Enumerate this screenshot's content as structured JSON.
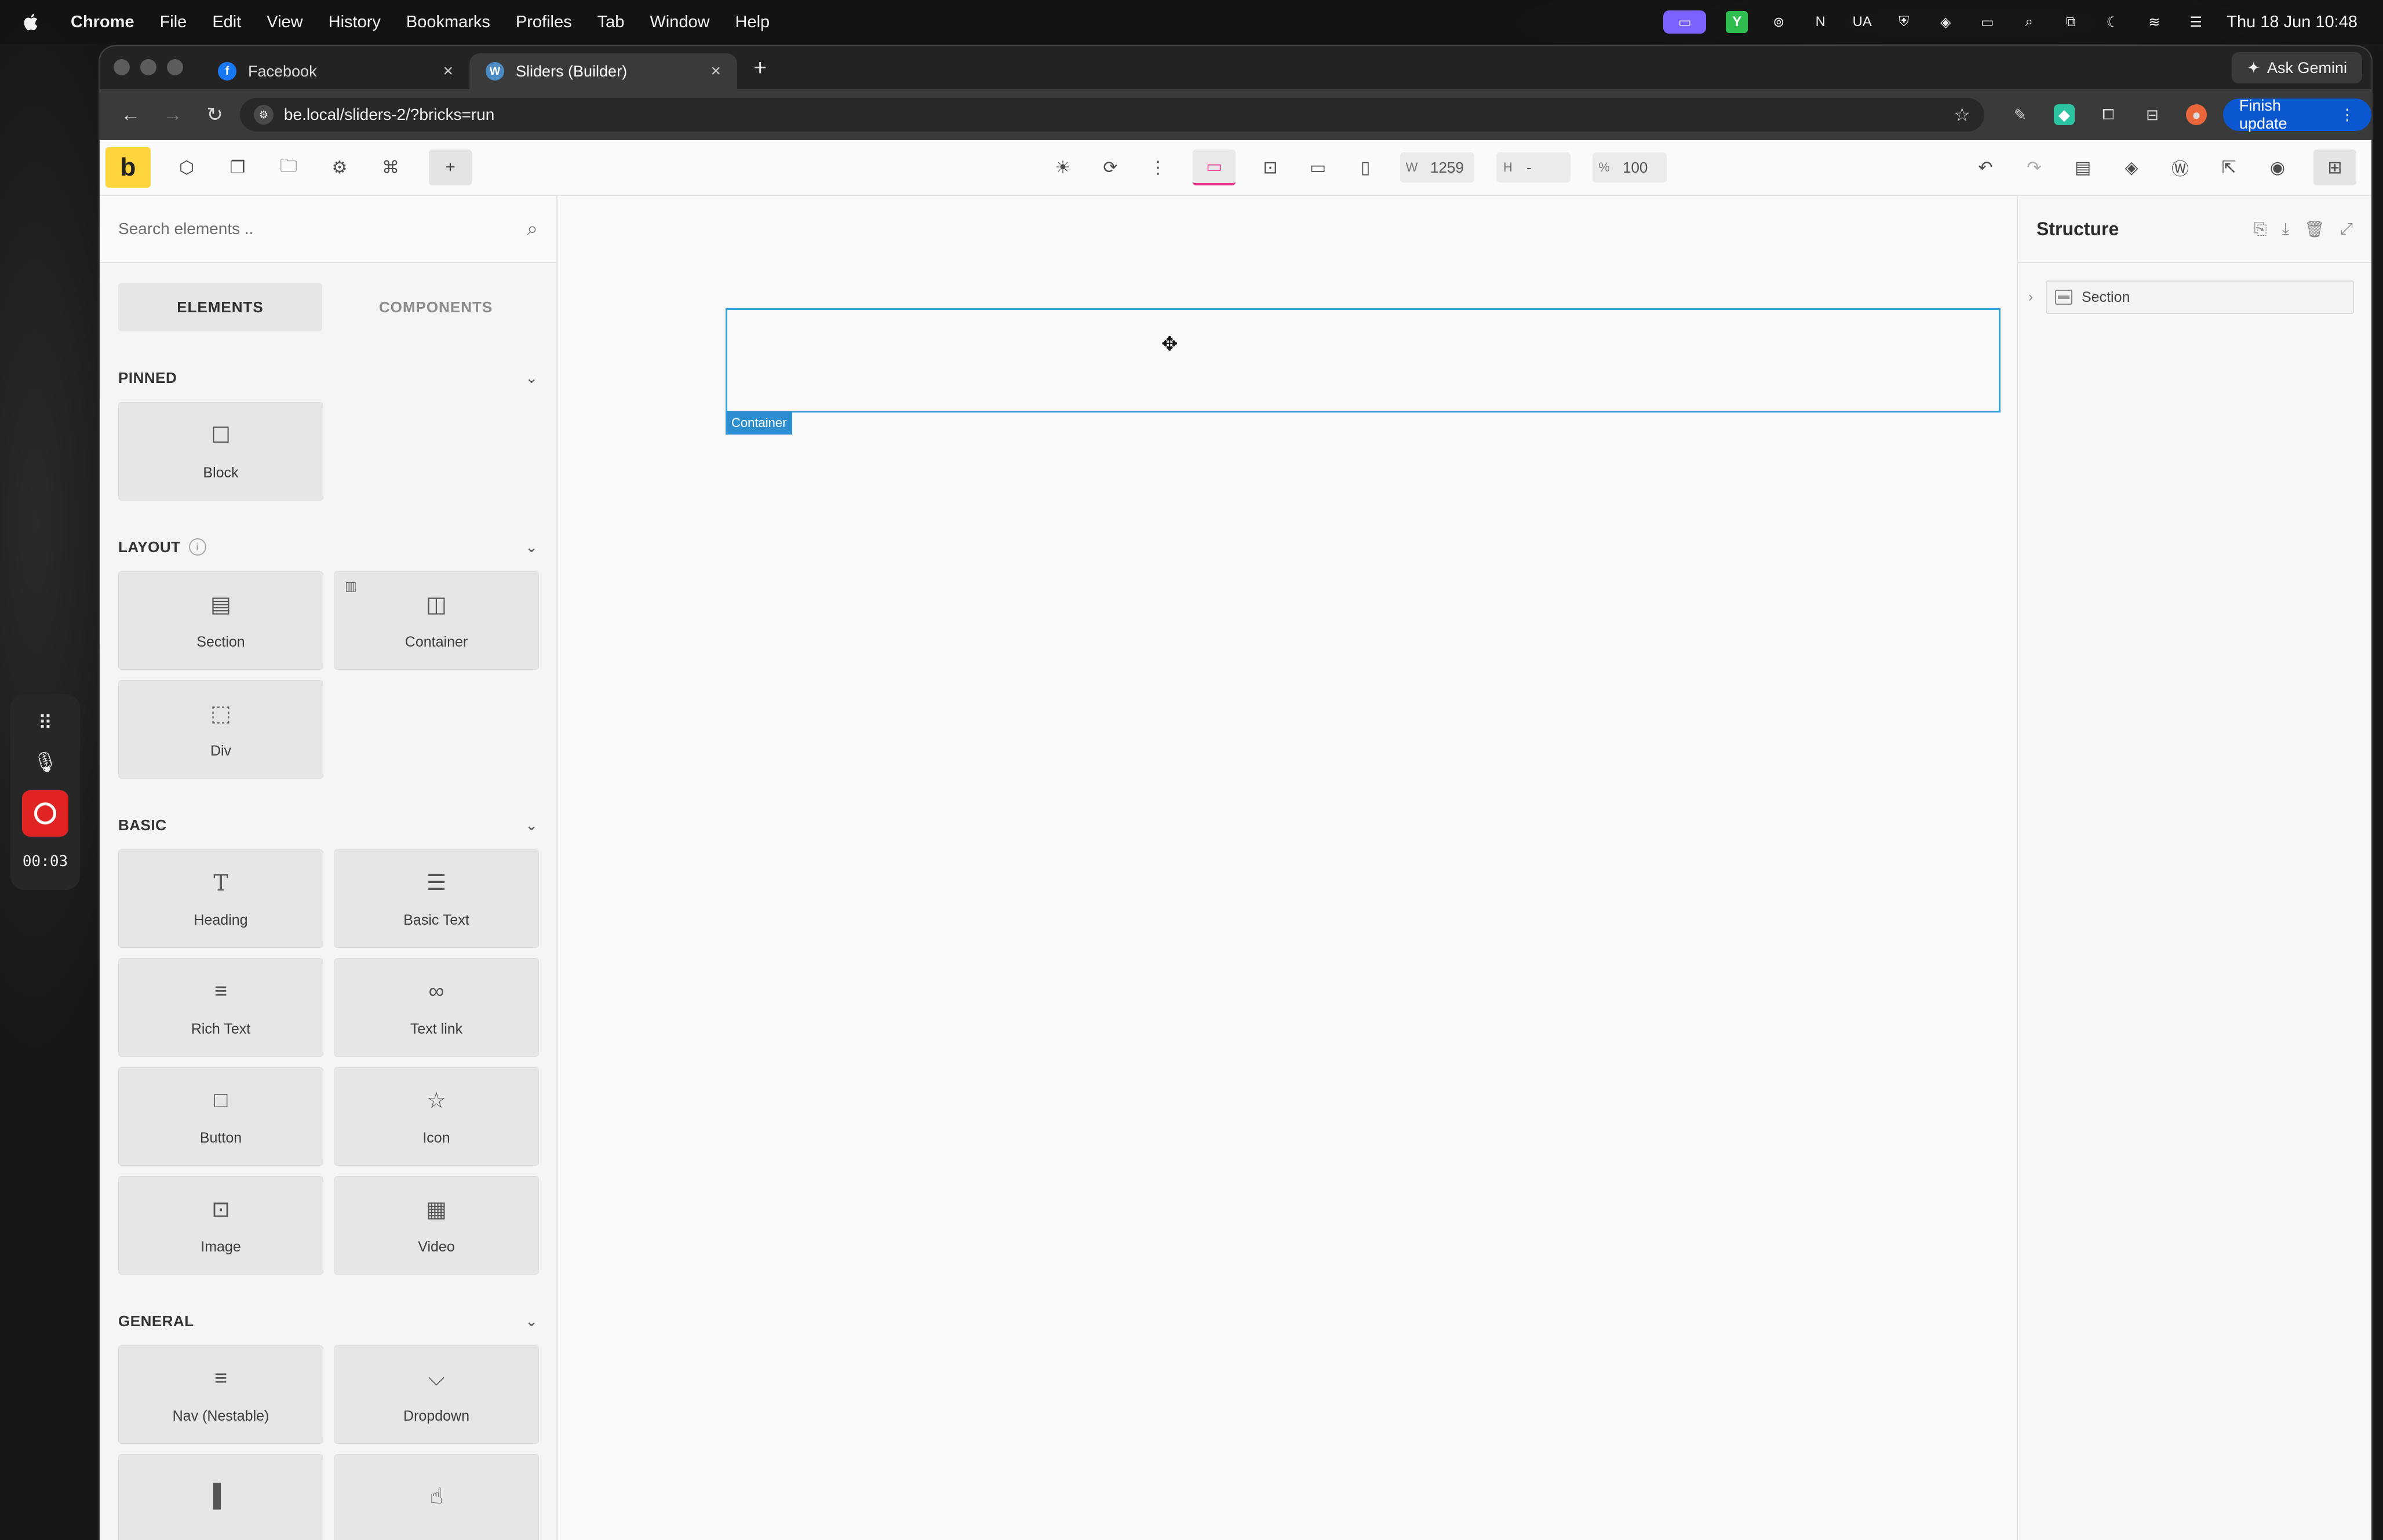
{
  "menubar": {
    "app": "Chrome",
    "items": [
      "File",
      "Edit",
      "View",
      "History",
      "Bookmarks",
      "Profiles",
      "Tab",
      "Window",
      "Help"
    ],
    "tray_ua": "UA",
    "tray_n": "N",
    "clock": "Thu 18 Jun  10:48"
  },
  "browser": {
    "tabs": [
      {
        "title": "Facebook",
        "icon": "facebook-icon"
      },
      {
        "title": "Sliders (Builder)",
        "icon": "wordpress-icon"
      }
    ],
    "gemini_label": "Ask Gemini",
    "url": "be.local/sliders-2/?bricks=run",
    "finish_update": "Finish update"
  },
  "toolbar": {
    "logo": "b",
    "width_label": "W",
    "width_value": "1259",
    "height_label": "H",
    "height_value": "-",
    "zoom_label": "%",
    "zoom_value": "100"
  },
  "left_panel": {
    "search_placeholder": "Search elements ..",
    "tabs": {
      "elements": "ELEMENTS",
      "components": "COMPONENTS"
    },
    "categories": {
      "pinned": {
        "title": "PINNED",
        "items": [
          {
            "label": "Block",
            "icon": "block-icon"
          }
        ]
      },
      "layout": {
        "title": "LAYOUT",
        "items": [
          {
            "label": "Section",
            "icon": "section-icon"
          },
          {
            "label": "Container",
            "icon": "container-icon"
          },
          {
            "label": "Div",
            "icon": "div-icon"
          }
        ]
      },
      "basic": {
        "title": "BASIC",
        "items": [
          {
            "label": "Heading",
            "icon": "heading-icon"
          },
          {
            "label": "Basic Text",
            "icon": "basic-text-icon"
          },
          {
            "label": "Rich Text",
            "icon": "rich-text-icon"
          },
          {
            "label": "Text link",
            "icon": "link-icon"
          },
          {
            "label": "Button",
            "icon": "button-icon"
          },
          {
            "label": "Icon",
            "icon": "star-icon"
          },
          {
            "label": "Image",
            "icon": "image-icon"
          },
          {
            "label": "Video",
            "icon": "video-icon"
          }
        ]
      },
      "general": {
        "title": "GENERAL",
        "items": [
          {
            "label": "Nav (Nestable)",
            "icon": "nav-icon"
          },
          {
            "label": "Dropdown",
            "icon": "dropdown-icon"
          }
        ]
      }
    }
  },
  "canvas": {
    "selected_tag": "Container"
  },
  "right_panel": {
    "title": "Structure",
    "tree": [
      {
        "label": "Section"
      }
    ]
  },
  "recorder": {
    "timer": "00:03"
  },
  "colors": {
    "bricks_yellow": "#ffd53e",
    "selection_blue": "#3aa0d8",
    "active_pink": "#e5338a",
    "finish_blue": "#0b57d0",
    "record_red": "#e02424"
  }
}
